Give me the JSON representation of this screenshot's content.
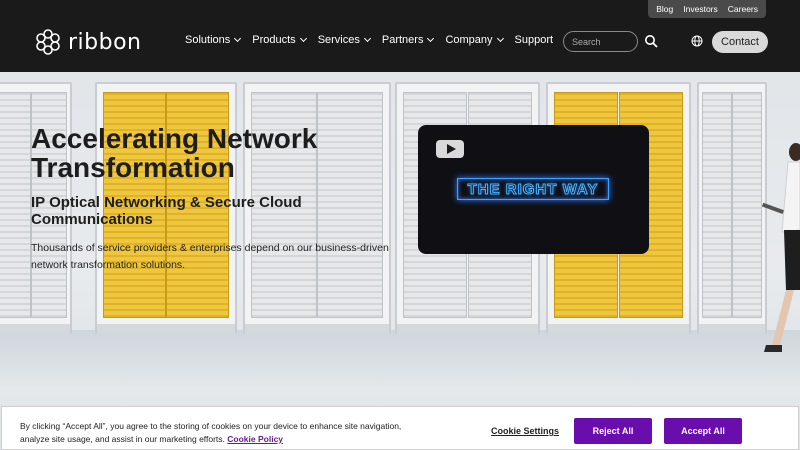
{
  "utility_nav": [
    "Blog",
    "Investors",
    "Careers"
  ],
  "logo": {
    "text": "ribbon"
  },
  "nav": {
    "items": [
      {
        "label": "Solutions",
        "has_dropdown": true
      },
      {
        "label": "Products",
        "has_dropdown": true
      },
      {
        "label": "Services",
        "has_dropdown": true
      },
      {
        "label": "Partners",
        "has_dropdown": true
      },
      {
        "label": "Company",
        "has_dropdown": true
      },
      {
        "label": "Support",
        "has_dropdown": false
      }
    ],
    "search_placeholder": "Search",
    "contact_label": "Contact"
  },
  "hero": {
    "title": "Accelerating Network Transformation",
    "subtitle": "IP Optical Networking & Secure Cloud Communications",
    "description": "Thousands of service providers & enterprises depend on our business-driven network transformation solutions."
  },
  "video": {
    "neon_text": "THE RIGHT WAY",
    "play_icon": "youtube-play-icon"
  },
  "cookie_banner": {
    "text": "By clicking “Accept All”, you agree to the storing of cookies on your device to enhance site navigation, analyze site usage, and assist in our marketing efforts.",
    "policy_link": "Cookie Policy",
    "settings_label": "Cookie Settings",
    "reject_label": "Reject All",
    "accept_label": "Accept All"
  },
  "colors": {
    "header_bg": "#1a1a1a",
    "accent_purple": "#6a0dad",
    "rack_yellow": "#efc640"
  }
}
